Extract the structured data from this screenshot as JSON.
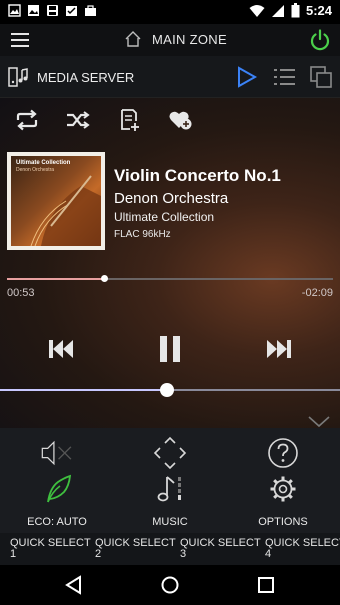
{
  "status_bar": {
    "time": "5:24",
    "left_icons": [
      "picture-icon",
      "image-icon",
      "save-icon",
      "checklist-icon",
      "briefcase-icon"
    ],
    "right_icons": [
      "wifi-icon",
      "signal-icon",
      "battery-icon"
    ]
  },
  "header": {
    "menu_icon": "hamburger-icon",
    "zone_icon": "home-icon",
    "zone_title": "MAIN ZONE",
    "power_icon": "power-icon",
    "power_color": "#4bcf4b"
  },
  "source_bar": {
    "source_label": "MEDIA SERVER",
    "play_color": "#3b82f6"
  },
  "controls": [
    "repeat-icon",
    "shuffle-icon",
    "add-to-playlist-icon",
    "add-favorite-icon"
  ],
  "now_playing": {
    "album_art": {
      "title": "Ultimate Collection",
      "subtitle": "Denon Orchestra"
    },
    "title": "Violin Concerto No.1",
    "artist": "Denon Orchestra",
    "album": "Ultimate Collection",
    "format": "FLAC 96kHz",
    "elapsed": "00:53",
    "remaining": "-02:09",
    "progress_fraction": 0.3
  },
  "volume_fraction": 0.49,
  "function_panel": {
    "items": [
      {
        "label": "ECO: AUTO",
        "icon": "leaf-icon"
      },
      {
        "label": "MUSIC",
        "icon": "music-note-icon"
      },
      {
        "label": "OPTIONS",
        "icon": "gear-icon"
      }
    ],
    "top_icons": [
      "mute-icon",
      "dpad-icon",
      "help-icon"
    ],
    "accent_color": "#3fbf3f"
  },
  "quick_select": [
    {
      "label": "QUICK SELECT",
      "num": "1"
    },
    {
      "label": "QUICK SELECT",
      "num": "2"
    },
    {
      "label": "QUICK SELECT",
      "num": "3"
    },
    {
      "label": "QUICK SELECT",
      "num": "4"
    }
  ]
}
